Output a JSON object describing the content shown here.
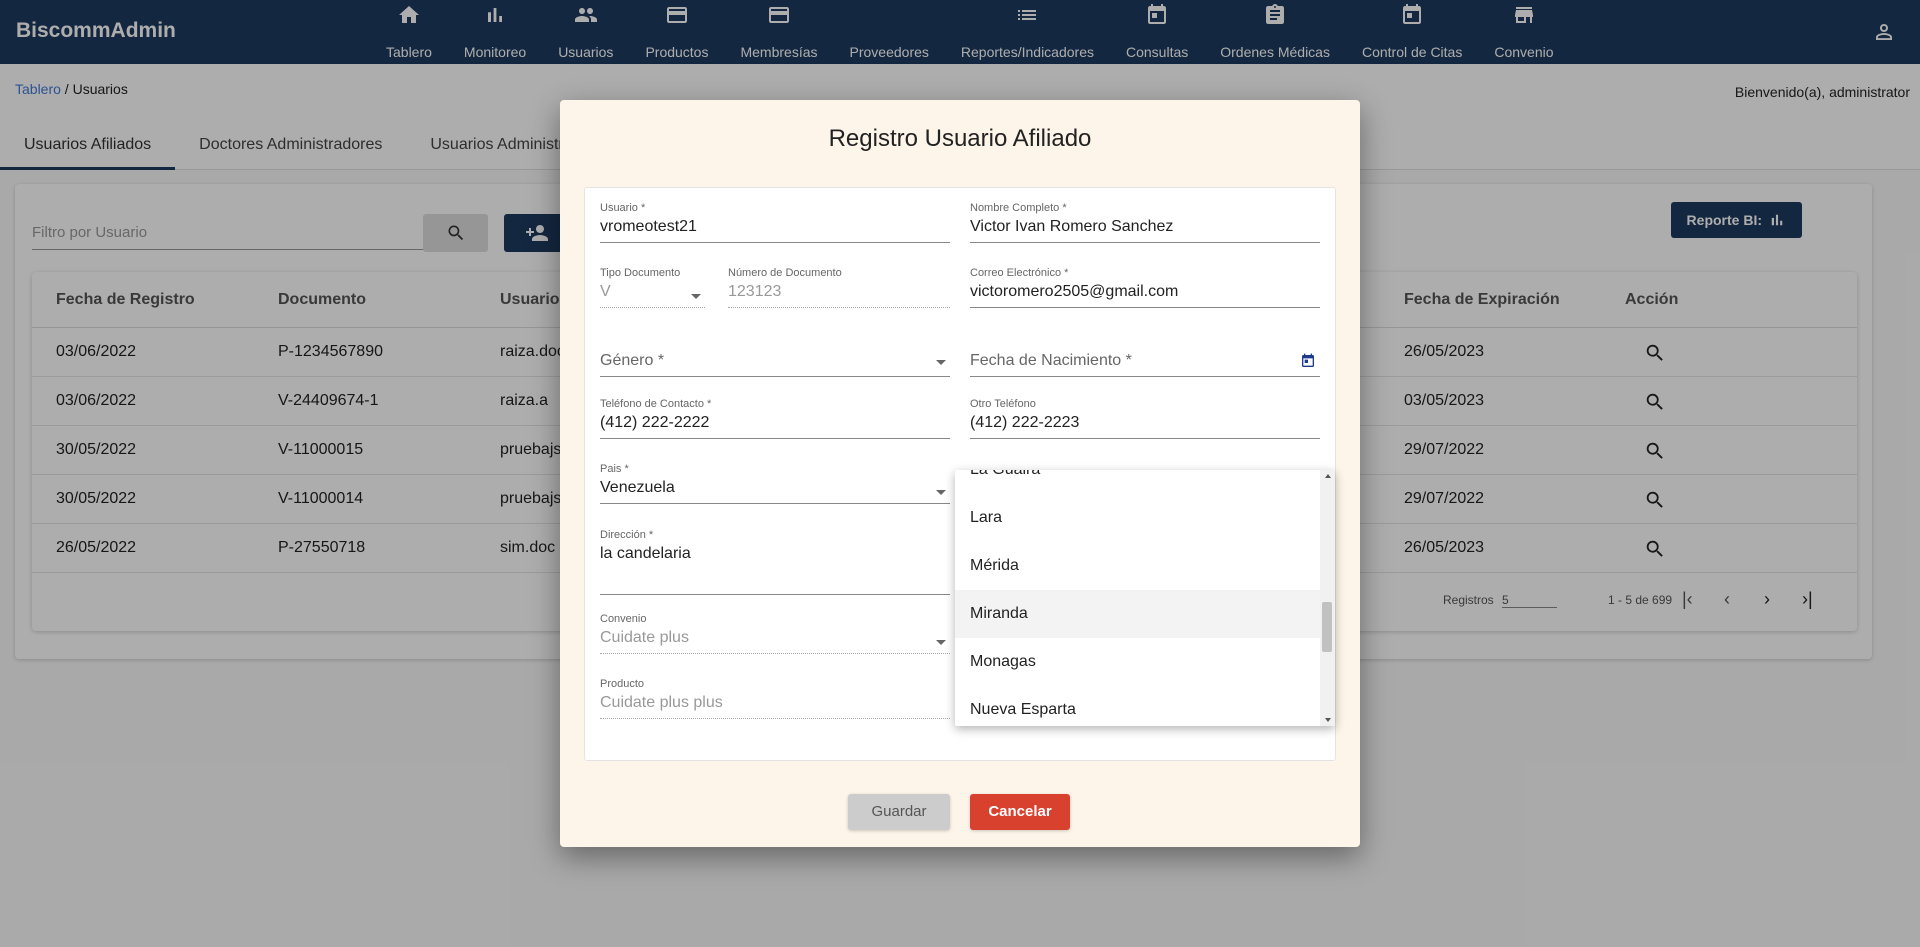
{
  "app": {
    "brand": "BiscommAdmin",
    "nav": [
      {
        "label": "Tablero",
        "icon": "home-icon"
      },
      {
        "label": "Monitoreo",
        "icon": "bar-chart-icon"
      },
      {
        "label": "Usuarios",
        "icon": "people-icon"
      },
      {
        "label": "Productos",
        "icon": "credit-card-icon"
      },
      {
        "label": "Membresías",
        "icon": "credit-card-icon"
      },
      {
        "label": "Proveedores",
        "icon": "list-icon"
      },
      {
        "label": "Reportes/Indicadores",
        "icon": "list-icon"
      },
      {
        "label": "Consultas",
        "icon": "calendar-icon"
      },
      {
        "label": "Ordenes Médicas",
        "icon": "clipboard-icon"
      },
      {
        "label": "Control de Citas",
        "icon": "calendar-icon"
      },
      {
        "label": "Convenio",
        "icon": "store-icon"
      }
    ],
    "user_icon": "person-icon"
  },
  "page": {
    "breadcrumb_link": "Tablero",
    "breadcrumb_current": " / Usuarios",
    "welcome": "Bienvenido(a), administrator",
    "tabs": [
      "Usuarios Afiliados",
      "Doctores Administradores",
      "Usuarios Administradores"
    ],
    "filter_placeholder": "Filtro por Usuario",
    "report_button": "Reporte BI:",
    "table": {
      "headers": [
        "Fecha de Registro",
        "Documento",
        "Usuario",
        "Fecha de Expiración",
        "Acción"
      ],
      "rows": [
        [
          "03/06/2022",
          "P-1234567890",
          "raiza.doc",
          "26/05/2023"
        ],
        [
          "03/06/2022",
          "V-24409674-1",
          "raiza.a",
          "03/05/2023"
        ],
        [
          "30/05/2022",
          "V-11000015",
          "pruebajs",
          "29/07/2022"
        ],
        [
          "30/05/2022",
          "V-11000014",
          "pruebajs",
          "29/07/2022"
        ],
        [
          "26/05/2022",
          "P-27550718",
          "sim.doc",
          "26/05/2023"
        ]
      ]
    },
    "paginator": {
      "label": "Registros",
      "page_size": "5",
      "range": "1 - 5 de 699"
    }
  },
  "dialog": {
    "title": "Registro Usuario Afiliado",
    "fields": {
      "usuario": {
        "label": "Usuario *",
        "value": "vromeotest21"
      },
      "nombre": {
        "label": "Nombre Completo *",
        "value": "Victor Ivan Romero Sanchez"
      },
      "tipo_doc": {
        "label": "Tipo Documento",
        "value": "V"
      },
      "num_doc": {
        "label": "Número de Documento",
        "value": "123123"
      },
      "correo": {
        "label": "Correo Electrónico *",
        "value": "victoromero2505@gmail.com"
      },
      "genero": {
        "label": "Género *"
      },
      "nacimiento": {
        "label": "Fecha de Nacimiento *"
      },
      "telefono": {
        "label": "Teléfono de Contacto *",
        "value": "(412) 222-2222"
      },
      "otro_tel": {
        "label": "Otro Teléfono",
        "value": "(412) 222-2223"
      },
      "pais": {
        "label": "Pais *",
        "value": "Venezuela"
      },
      "direccion": {
        "label": "Dirección *",
        "value": "la candelaria"
      },
      "convenio": {
        "label": "Convenio",
        "value": "Cuidate plus"
      },
      "producto": {
        "label": "Producto",
        "value": "Cuidate plus plus"
      }
    },
    "state_options": [
      "La Guaira",
      "Lara",
      "Mérida",
      "Miranda",
      "Monagas",
      "Nueva Esparta"
    ],
    "highlighted_option": "Miranda",
    "save_label": "Guardar",
    "cancel_label": "Cancelar"
  },
  "colors": {
    "primary": "#1e3a5f",
    "cancel": "#d9412f",
    "dialog_bg": "#fdf5e9"
  }
}
